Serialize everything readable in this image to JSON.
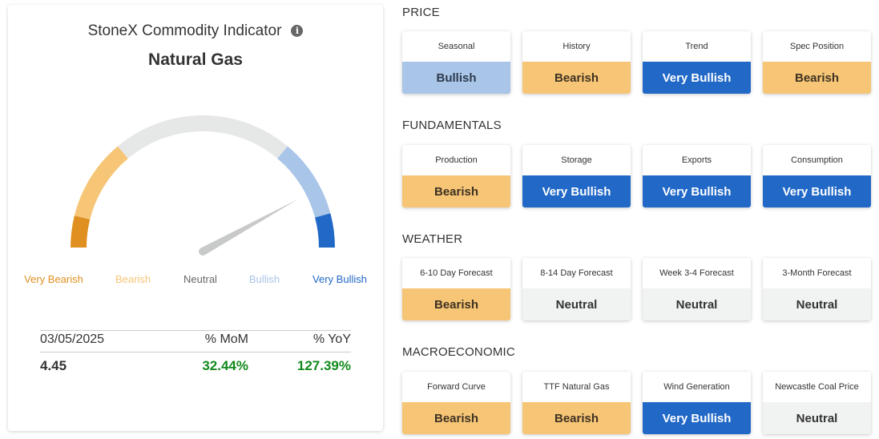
{
  "indicator": {
    "title": "StoneX Commodity Indicator",
    "info_icon": "info-icon",
    "commodity": "Natural Gas",
    "scale": [
      {
        "label": "Very Bearish",
        "color": "#e09020"
      },
      {
        "label": "Bearish",
        "color": "#f6c576"
      },
      {
        "label": "Neutral",
        "color": "#666666"
      },
      {
        "label": "Bullish",
        "color": "#a9c5e8"
      },
      {
        "label": "Very Bullish",
        "color": "#2168c7"
      }
    ],
    "needle_value_pct": 84,
    "stats": {
      "date": "03/05/2025",
      "mom_label": "% MoM",
      "yoy_label": "% YoY",
      "price": "4.45",
      "mom": "32.44%",
      "yoy": "127.39%",
      "positive_color": "#138a1e"
    }
  },
  "sections": [
    {
      "title": "PRICE",
      "cards": [
        {
          "label": "Seasonal",
          "value": "Bullish",
          "status": "bullish"
        },
        {
          "label": "History",
          "value": "Bearish",
          "status": "bearish"
        },
        {
          "label": "Trend",
          "value": "Very Bullish",
          "status": "verybullish"
        },
        {
          "label": "Spec Position",
          "value": "Bearish",
          "status": "bearish"
        }
      ]
    },
    {
      "title": "FUNDAMENTALS",
      "cards": [
        {
          "label": "Production",
          "value": "Bearish",
          "status": "bearish"
        },
        {
          "label": "Storage",
          "value": "Very Bullish",
          "status": "verybullish"
        },
        {
          "label": "Exports",
          "value": "Very Bullish",
          "status": "verybullish"
        },
        {
          "label": "Consumption",
          "value": "Very Bullish",
          "status": "verybullish"
        }
      ]
    },
    {
      "title": "WEATHER",
      "cards": [
        {
          "label": "6-10 Day Forecast",
          "value": "Bearish",
          "status": "bearish"
        },
        {
          "label": "8-14 Day Forecast",
          "value": "Neutral",
          "status": "neutral"
        },
        {
          "label": "Week 3-4 Forecast",
          "value": "Neutral",
          "status": "neutral"
        },
        {
          "label": "3-Month Forecast",
          "value": "Neutral",
          "status": "neutral"
        }
      ]
    },
    {
      "title": "MACROECONOMIC",
      "cards": [
        {
          "label": "Forward Curve",
          "value": "Bearish",
          "status": "bearish"
        },
        {
          "label": "TTF Natural Gas",
          "value": "Bearish",
          "status": "bearish"
        },
        {
          "label": "Wind Generation",
          "value": "Very Bullish",
          "status": "verybullish"
        },
        {
          "label": "Newcastle Coal Price",
          "value": "Neutral",
          "status": "neutral"
        }
      ]
    }
  ]
}
